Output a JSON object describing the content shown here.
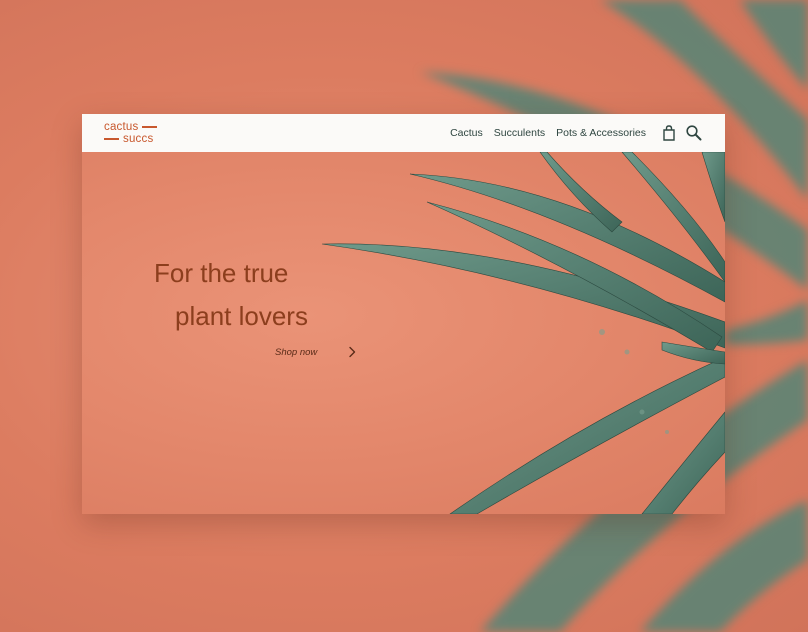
{
  "brand": {
    "line1": "cactus",
    "line2": "succs"
  },
  "nav": {
    "links": [
      "Cactus",
      "Succulents",
      "Pots & Accessories"
    ],
    "icons": [
      "shopping-bag-icon",
      "search-icon"
    ]
  },
  "hero": {
    "headline_line1": "For the true",
    "headline_line2": "plant lovers",
    "cta_label": "Shop now",
    "cta_icon": "chevron-right-icon"
  },
  "colors": {
    "background": "#e3876b",
    "brand": "#c8582e",
    "headline": "#8c3e1d",
    "nav_text": "#2f4641",
    "plant": "#4f7a6c"
  }
}
